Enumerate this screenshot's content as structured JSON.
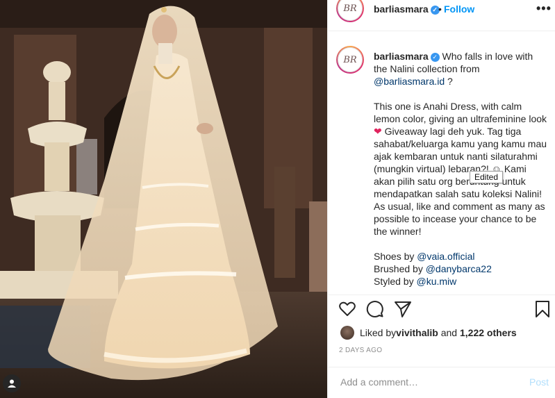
{
  "post": {
    "username": "barliasmara",
    "follow_label": "Follow",
    "dot": "•",
    "more_label": "•••",
    "avatar_mark": "BR"
  },
  "caption": {
    "username": "barliasmara",
    "line1": "Who falls in love with the Nalini collection from",
    "mention_brand": "@barliasmara.id",
    "line1_end": " ?",
    "para2_a": "This one is Anahi Dress, with calm lemon color, giving an ultrafeminine look ",
    "heart": "❤",
    "para2_b": " Giveaway lagi deh yuk. Tag tiga sahabat/keluarga kamu yang kamu mau ajak kembaran untuk nanti silaturahmi (mungkin virtual) lebaran?! ☺ Kami akan pilih satu org beruntung untuk mendapatkan salah satu koleksi Nalini! As usual, like and comment as many as possible to incease your chance to be the winner!",
    "shoes_label": "Shoes by ",
    "shoes_mention": "@vaia.official",
    "brushed_label": "Brushed by ",
    "brushed_mention": "@danybarca22",
    "styled_label": "Styled by ",
    "styled_mention": "@ku.miw"
  },
  "tooltip": "Edited",
  "likes": {
    "prefix": "Liked by ",
    "liker": "vivithalib",
    "middle": " and ",
    "count": "1,222 others"
  },
  "timestamp": "2 DAYS AGO",
  "comment": {
    "placeholder": "Add a comment…",
    "post_label": "Post"
  },
  "icons": [
    "heart-icon",
    "comment-icon",
    "share-icon",
    "bookmark-icon",
    "verified-icon",
    "user-tag-icon"
  ],
  "colors": {
    "link": "#0095f6",
    "mention": "#00376b",
    "verified": "#3897f0",
    "muted": "#8e8e8e",
    "post_disabled": "#b2dffc"
  }
}
